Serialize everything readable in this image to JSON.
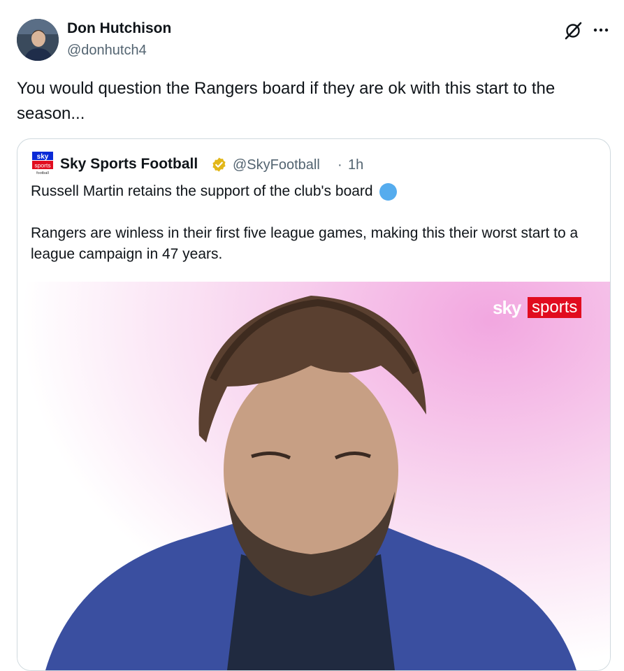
{
  "tweet": {
    "author_name": "Don Hutchison",
    "author_handle": "@donhutch4",
    "text": "You would question the Rangers board if they are ok with this start to the season..."
  },
  "quoted": {
    "author_name": "Sky Sports Football",
    "author_handle": "@SkyFootball",
    "separator": "·",
    "time": "1h",
    "text_line1": "Russell Martin retains the support of the club's board",
    "text_line2": "Rangers are winless in their first five league games, making this their worst start to a league campaign in 47 years.",
    "avatar_sky": "sky",
    "avatar_sports": "sports",
    "avatar_football": "football",
    "media_logo_sky": "sky",
    "media_logo_sports": "sports"
  },
  "icons": {
    "grok": "grok-icon",
    "more": "more-icon",
    "verified": "verified-badge-icon",
    "emoji": "blue-circle-emoji"
  },
  "colors": {
    "text": "#0f1419",
    "secondary": "#536471",
    "border": "#cfd9de",
    "verified_gold": "#e2b719",
    "sky_red": "#e10c1f",
    "sky_blue": "#0a2ad6",
    "blue_circle": "#55acee"
  }
}
